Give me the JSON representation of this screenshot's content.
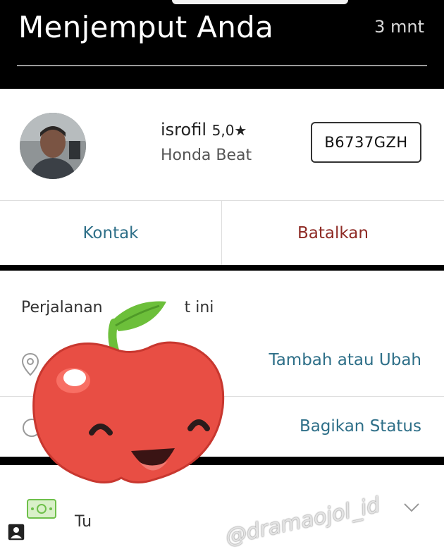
{
  "header": {
    "title": "Menjemput Anda",
    "eta": "3 mnt"
  },
  "driver": {
    "name": "isrofil",
    "rating": "5,0★",
    "vehicle": "Honda Beat",
    "plate": "B6737GZH",
    "avatar_icon": "driver-photo"
  },
  "actions": {
    "contact": "Kontak",
    "cancel": "Batalkan"
  },
  "trip": {
    "title_left": "Perjalanan",
    "title_right": "t ini",
    "destination_action": "Tambah atau Ubah",
    "share_action": "Bagikan Status"
  },
  "payment": {
    "label": "Tu"
  },
  "watermark": "@dramaojol_id",
  "colors": {
    "accent": "#2e6f88",
    "danger": "#8e2a24",
    "cash": "#6ec04a"
  }
}
